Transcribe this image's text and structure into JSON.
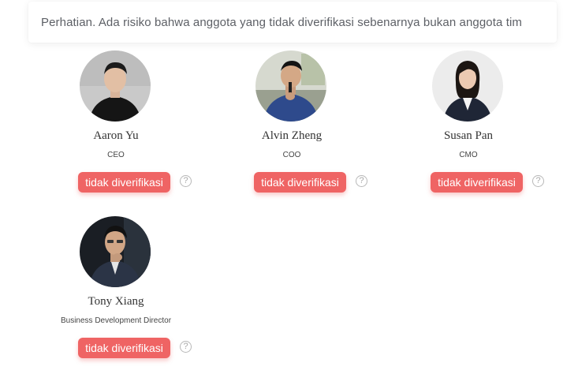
{
  "notice": {
    "text": "Perhatian. Ada risiko bahwa anggota yang tidak diverifikasi sebenarnya bukan anggota tim"
  },
  "team": [
    {
      "name": "Aaron Yu",
      "role": "CEO",
      "status": "tidak diverifikasi",
      "help": "?"
    },
    {
      "name": "Alvin Zheng",
      "role": "COO",
      "status": "tidak diverifikasi",
      "help": "?"
    },
    {
      "name": "Susan Pan",
      "role": "CMO",
      "status": "tidak diverifikasi",
      "help": "?"
    },
    {
      "name": "Tony Xiang",
      "role": "Business Development Director",
      "status": "tidak diverifikasi",
      "help": "?"
    }
  ],
  "colors": {
    "badge": "#ef6464",
    "notice_text": "#5d6066"
  }
}
